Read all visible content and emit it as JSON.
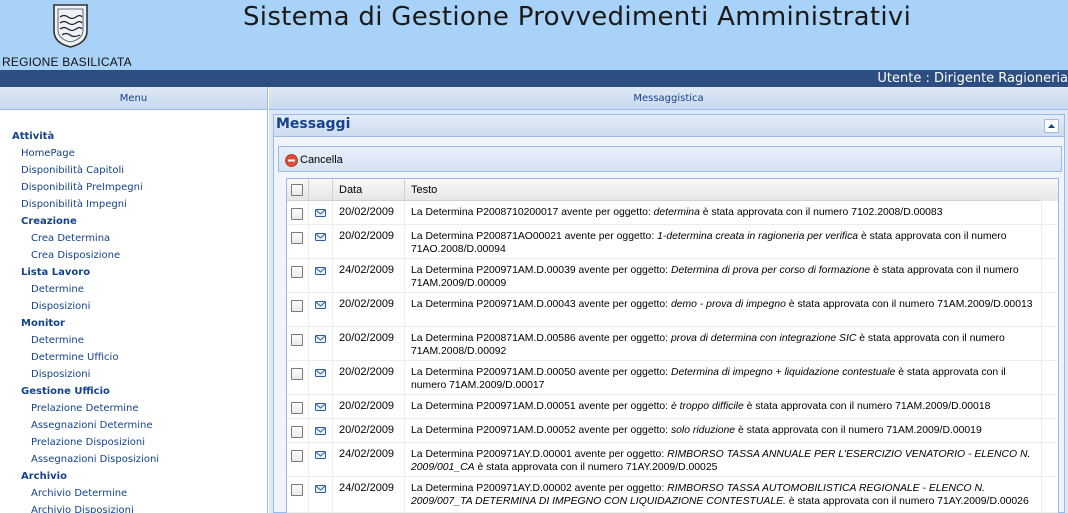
{
  "header": {
    "title": "Sistema di Gestione Provvedimenti Amministrativi",
    "region": "REGIONE BASILICATA",
    "logo": "regione-basilicata-crest"
  },
  "userbar": {
    "user": "Utente : Dirigente Ragioneria"
  },
  "menu": {
    "header": "Menu",
    "entries": [
      {
        "type": "section",
        "label": "Attività",
        "level": 0
      },
      {
        "type": "item",
        "label": "HomePage",
        "level": 1
      },
      {
        "type": "item",
        "label": "Disponibilità Capitoli",
        "level": 1
      },
      {
        "type": "item",
        "label": "Disponibilità PreImpegni",
        "level": 1
      },
      {
        "type": "item",
        "label": "Disponibilità Impegni",
        "level": 1
      },
      {
        "type": "section",
        "label": "Creazione",
        "level": 1
      },
      {
        "type": "item",
        "label": "Crea Determina",
        "level": 2
      },
      {
        "type": "item",
        "label": "Crea Disposizione",
        "level": 2
      },
      {
        "type": "section",
        "label": "Lista Lavoro",
        "level": 1
      },
      {
        "type": "item",
        "label": "Determine",
        "level": 2
      },
      {
        "type": "item",
        "label": "Disposizioni",
        "level": 2
      },
      {
        "type": "section",
        "label": "Monitor",
        "level": 1
      },
      {
        "type": "item",
        "label": "Determine",
        "level": 2
      },
      {
        "type": "item",
        "label": "Determine Ufficio",
        "level": 2
      },
      {
        "type": "item",
        "label": "Disposizioni",
        "level": 2
      },
      {
        "type": "section",
        "label": "Gestione Ufficio",
        "level": 1
      },
      {
        "type": "item",
        "label": "Prelazione Determine",
        "level": 2
      },
      {
        "type": "item",
        "label": "Assegnazioni Determine",
        "level": 2
      },
      {
        "type": "item",
        "label": "Prelazione Disposizioni",
        "level": 2
      },
      {
        "type": "item",
        "label": "Assegnazioni Disposizioni",
        "level": 2
      },
      {
        "type": "section",
        "label": "Archivio",
        "level": 1
      },
      {
        "type": "item",
        "label": "Archivio Determine",
        "level": 2
      },
      {
        "type": "item",
        "label": "Archivio Disposizioni",
        "level": 2
      }
    ]
  },
  "content": {
    "header": "Messaggistica",
    "panel_title": "Messaggi",
    "toolbar": {
      "cancel_label": "Cancella"
    },
    "grid": {
      "columns": [
        "Data",
        "Testo"
      ],
      "rows": [
        {
          "date": "20/02/2009",
          "lines": 1,
          "parts": [
            {
              "t": "La Determina P2008710200017 avente per oggetto: "
            },
            {
              "t": "determina",
              "i": true
            },
            {
              "t": " è stata approvata con il numero 7102.2008/D.00083"
            }
          ]
        },
        {
          "date": "20/02/2009",
          "lines": 2,
          "parts": [
            {
              "t": "La Determina P200871AO00021 avente per oggetto: "
            },
            {
              "t": "1-determina creata in ragioneria per verifica",
              "i": true
            },
            {
              "t": " è stata approvata con il numero 71AO.2008/D.00094"
            }
          ]
        },
        {
          "date": "24/02/2009",
          "lines": 2,
          "parts": [
            {
              "t": "La Determina P200971AM.D.00039 avente per oggetto: "
            },
            {
              "t": "Determina di prova per corso di formazione",
              "i": true
            },
            {
              "t": " è stata approvata con il numero 71AM.2009/D.00009"
            }
          ]
        },
        {
          "date": "20/02/2009",
          "lines": 2,
          "parts": [
            {
              "t": "La Determina P200971AM.D.00043 avente per oggetto: "
            },
            {
              "t": "demo - prova di impegno",
              "i": true
            },
            {
              "t": " è stata approvata con il numero 71AM.2009/D.00013"
            }
          ]
        },
        {
          "date": "20/02/2009",
          "lines": 2,
          "parts": [
            {
              "t": "La Determina P200871AM.D.00586 avente per oggetto: "
            },
            {
              "t": "prova di determina con integrazione SIC",
              "i": true
            },
            {
              "t": " è stata approvata con il numero 71AM.2008/D.00092"
            }
          ]
        },
        {
          "date": "20/02/2009",
          "lines": 2,
          "parts": [
            {
              "t": "La Determina P200971AM.D.00050 avente per oggetto: "
            },
            {
              "t": "Determina di impegno + liquidazione contestuale",
              "i": true
            },
            {
              "t": " è stata approvata con il numero 71AM.2009/D.00017"
            }
          ]
        },
        {
          "date": "20/02/2009",
          "lines": 1,
          "parts": [
            {
              "t": "La Determina P200971AM.D.00051 avente per oggetto: "
            },
            {
              "t": "è troppo difficile",
              "i": true
            },
            {
              "t": " è stata approvata con il numero 71AM.2009/D.00018"
            }
          ]
        },
        {
          "date": "20/02/2009",
          "lines": 1,
          "parts": [
            {
              "t": "La Determina P200971AM.D.00052 avente per oggetto: "
            },
            {
              "t": "solo riduzione",
              "i": true
            },
            {
              "t": " è stata approvata con il numero 71AM.2009/D.00019"
            }
          ]
        },
        {
          "date": "24/02/2009",
          "lines": 2,
          "parts": [
            {
              "t": "La Determina P200971AY.D.00001 avente per oggetto: "
            },
            {
              "t": "RIMBORSO TASSA ANNUALE PER L'ESERCIZIO VENATORIO - ELENCO N. 2009/001_CA",
              "i": true
            },
            {
              "t": " è stata approvata con il numero 71AY.2009/D.00025"
            }
          ]
        },
        {
          "date": "24/02/2009",
          "lines": 3,
          "parts": [
            {
              "t": "La Determina P200971AY.D.00002 avente per oggetto: "
            },
            {
              "t": "RIMBORSO TASSA AUTOMOBILISTICA REGIONALE - ELENCO N. 2009/007_TA DETERMINA DI IMPEGNO CON LIQUIDAZIONE CONTESTUALE.",
              "i": true
            },
            {
              "t": " è stata approvata con il numero 71AY.2009/D.00026"
            }
          ]
        }
      ]
    }
  },
  "colors": {
    "header_bg": "#a9d2f8",
    "userbar_bg": "#2d4e80",
    "panel_title": "#15428b",
    "border": "#99bbe8"
  },
  "icons": {
    "cancel": "remove-circle-icon",
    "message": "envelope-icon",
    "collapse": "chevron-up-icon"
  }
}
